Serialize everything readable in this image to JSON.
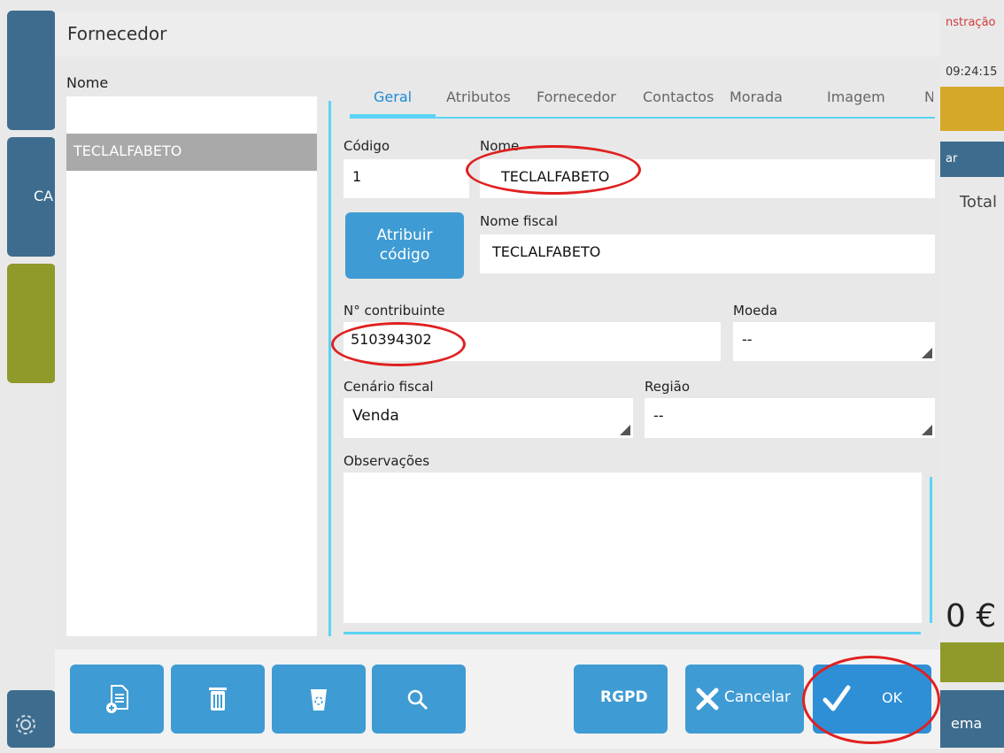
{
  "background": {
    "top_right_text": "nstração",
    "clock": "09:24:15",
    "side_label_left": "CA",
    "side_label_right_top": "ar",
    "total_label": "Total",
    "amount_fragment": "0 €",
    "bottom_right_fragment": "ema"
  },
  "dialog": {
    "title": "Fornecedor",
    "list_label": "Nome",
    "list_items": [
      "TECLALFABETO"
    ],
    "tabs": [
      "Geral",
      "Atributos",
      "Fornecedor",
      "Contactos",
      "Morada",
      "Imagem",
      "N"
    ],
    "active_tab": "Geral",
    "form": {
      "codigo_label": "Código",
      "codigo_value": "1",
      "nome_label": "Nome",
      "nome_value": "TECLALFABETO",
      "attr_button_line1": "Atribuir",
      "attr_button_line2": "código",
      "nome_fiscal_label": "Nome fiscal",
      "nome_fiscal_value": "TECLALFABETO",
      "contribuinte_label": "N° contribuinte",
      "contribuinte_value": "510394302",
      "moeda_label": "Moeda",
      "moeda_value": "--",
      "cenario_label": "Cenário fiscal",
      "cenario_value": "Venda",
      "regiao_label": "Região",
      "regiao_value": "--",
      "observacoes_label": "Observações",
      "observacoes_value": ""
    },
    "footer": {
      "rgpd_label": "RGPD",
      "cancel_label": "Cancelar",
      "ok_label": "OK"
    }
  },
  "colors": {
    "accent_blue": "#3f9bd3",
    "line_cyan": "#5bd3f5",
    "annotation_red": "#e02020"
  },
  "icons": [
    "new-document-icon",
    "trash-icon",
    "recycle-bin-icon",
    "search-icon",
    "close-x-icon",
    "checkmark-icon",
    "gear-icon"
  ]
}
